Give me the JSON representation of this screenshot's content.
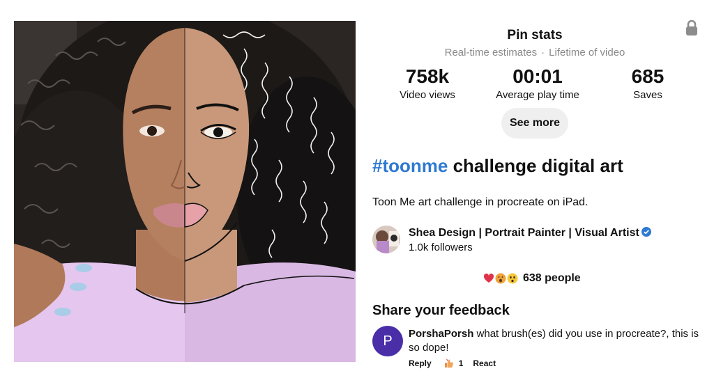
{
  "stats": {
    "title": "Pin stats",
    "subtitle_left": "Real-time estimates",
    "separator": "·",
    "subtitle_right": "Lifetime of video",
    "metrics": [
      {
        "value": "758k",
        "label": "Video views"
      },
      {
        "value": "00:01",
        "label": "Average play time"
      },
      {
        "value": "685",
        "label": "Saves"
      }
    ],
    "see_more_label": "See more"
  },
  "pin": {
    "hashtag": "#toonme",
    "title_rest": " challenge digital art",
    "description": "Toon Me art challenge in procreate on iPad."
  },
  "creator": {
    "name": "Shea Design | Portrait Painter | Visual Artist",
    "followers": "1.0k followers"
  },
  "reactions": {
    "icons": [
      "heart-eyes-emoji",
      "wow-emoji",
      "surprised-emoji"
    ],
    "count": "638 people"
  },
  "feedback": {
    "heading": "Share your feedback",
    "comment": {
      "avatar_initial": "P",
      "author": "PorshaPorsh",
      "text": " what brush(es) did you use in procreate?, this is so dope!",
      "reply_label": "Reply",
      "like_count": "1",
      "react_label": "React"
    }
  },
  "colors": {
    "hashtag": "#2f7ad1",
    "see_more_bg": "#efefef",
    "commenter_avatar": "#4a2ea8",
    "verified": "#2f7ad1"
  }
}
